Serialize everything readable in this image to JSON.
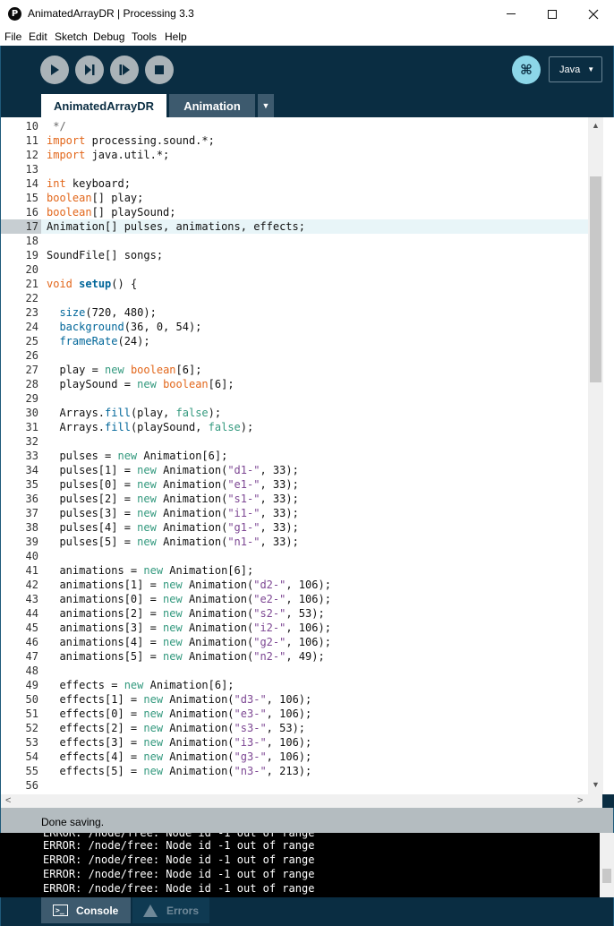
{
  "window": {
    "title": "AnimatedArrayDR | Processing 3.3",
    "app_icon_glyph": "P"
  },
  "menu": [
    "File",
    "Edit",
    "Sketch",
    "Debug",
    "Tools",
    "Help"
  ],
  "toolbar": {
    "mode_glyph": "⌘",
    "language": "Java",
    "language_caret": "▼"
  },
  "tabs": {
    "active": "AnimatedArrayDR",
    "inactive": "Animation",
    "menu_glyph": "▼"
  },
  "editor": {
    "current_line": 17,
    "lines": [
      {
        "n": "10",
        "t": [
          [
            "cm",
            " */"
          ]
        ]
      },
      {
        "n": "11",
        "t": [
          [
            "kw",
            "import"
          ],
          [
            "",
            " processing.sound.*;"
          ]
        ]
      },
      {
        "n": "12",
        "t": [
          [
            "kw",
            "import"
          ],
          [
            "",
            " java.util.*;"
          ]
        ]
      },
      {
        "n": "13",
        "t": []
      },
      {
        "n": "14",
        "t": [
          [
            "kw",
            "int"
          ],
          [
            "",
            " keyboard;"
          ]
        ]
      },
      {
        "n": "15",
        "t": [
          [
            "kw",
            "boolean"
          ],
          [
            "",
            "[] play;"
          ]
        ]
      },
      {
        "n": "16",
        "t": [
          [
            "kw",
            "boolean"
          ],
          [
            "",
            "[] playSound;"
          ]
        ]
      },
      {
        "n": "17",
        "t": [
          [
            "",
            "Animation[] pulses, animations, effects;"
          ]
        ]
      },
      {
        "n": "18",
        "t": []
      },
      {
        "n": "19",
        "t": [
          [
            "",
            "SoundFile[] songs;"
          ]
        ]
      },
      {
        "n": "20",
        "t": []
      },
      {
        "n": "21",
        "t": [
          [
            "kw",
            "void"
          ],
          [
            "",
            " "
          ],
          [
            "fnb",
            "setup"
          ],
          [
            "",
            "() {"
          ]
        ]
      },
      {
        "n": "22",
        "t": []
      },
      {
        "n": "23",
        "t": [
          [
            "",
            "  "
          ],
          [
            "fn",
            "size"
          ],
          [
            "",
            "(720, 480);"
          ]
        ]
      },
      {
        "n": "24",
        "t": [
          [
            "",
            "  "
          ],
          [
            "fn",
            "background"
          ],
          [
            "",
            "(36, 0, 54);"
          ]
        ]
      },
      {
        "n": "25",
        "t": [
          [
            "",
            "  "
          ],
          [
            "fn",
            "frameRate"
          ],
          [
            "",
            "(24);"
          ]
        ]
      },
      {
        "n": "26",
        "t": []
      },
      {
        "n": "27",
        "t": [
          [
            "",
            "  play = "
          ],
          [
            "kw2",
            "new"
          ],
          [
            "",
            " "
          ],
          [
            "kw",
            "boolean"
          ],
          [
            "",
            "[6];"
          ]
        ]
      },
      {
        "n": "28",
        "t": [
          [
            "",
            "  playSound = "
          ],
          [
            "kw2",
            "new"
          ],
          [
            "",
            " "
          ],
          [
            "kw",
            "boolean"
          ],
          [
            "",
            "[6];"
          ]
        ]
      },
      {
        "n": "29",
        "t": []
      },
      {
        "n": "30",
        "t": [
          [
            "",
            "  Arrays."
          ],
          [
            "fn",
            "fill"
          ],
          [
            "",
            "(play, "
          ],
          [
            "kw2",
            "false"
          ],
          [
            "",
            ");"
          ]
        ]
      },
      {
        "n": "31",
        "t": [
          [
            "",
            "  Arrays."
          ],
          [
            "fn",
            "fill"
          ],
          [
            "",
            "(playSound, "
          ],
          [
            "kw2",
            "false"
          ],
          [
            "",
            ");"
          ]
        ]
      },
      {
        "n": "32",
        "t": []
      },
      {
        "n": "33",
        "t": [
          [
            "",
            "  pulses = "
          ],
          [
            "kw2",
            "new"
          ],
          [
            "",
            " Animation[6];"
          ]
        ]
      },
      {
        "n": "34",
        "t": [
          [
            "",
            "  pulses[1] = "
          ],
          [
            "kw2",
            "new"
          ],
          [
            "",
            " Animation("
          ],
          [
            "str",
            "\"d1-\""
          ],
          [
            "",
            ", 33);"
          ]
        ]
      },
      {
        "n": "35",
        "t": [
          [
            "",
            "  pulses[0] = "
          ],
          [
            "kw2",
            "new"
          ],
          [
            "",
            " Animation("
          ],
          [
            "str",
            "\"e1-\""
          ],
          [
            "",
            ", 33);"
          ]
        ]
      },
      {
        "n": "36",
        "t": [
          [
            "",
            "  pulses[2] = "
          ],
          [
            "kw2",
            "new"
          ],
          [
            "",
            " Animation("
          ],
          [
            "str",
            "\"s1-\""
          ],
          [
            "",
            ", 33);"
          ]
        ]
      },
      {
        "n": "37",
        "t": [
          [
            "",
            "  pulses[3] = "
          ],
          [
            "kw2",
            "new"
          ],
          [
            "",
            " Animation("
          ],
          [
            "str",
            "\"i1-\""
          ],
          [
            "",
            ", 33);"
          ]
        ]
      },
      {
        "n": "38",
        "t": [
          [
            "",
            "  pulses[4] = "
          ],
          [
            "kw2",
            "new"
          ],
          [
            "",
            " Animation("
          ],
          [
            "str",
            "\"g1-\""
          ],
          [
            "",
            ", 33);"
          ]
        ]
      },
      {
        "n": "39",
        "t": [
          [
            "",
            "  pulses[5] = "
          ],
          [
            "kw2",
            "new"
          ],
          [
            "",
            " Animation("
          ],
          [
            "str",
            "\"n1-\""
          ],
          [
            "",
            ", 33);"
          ]
        ]
      },
      {
        "n": "40",
        "t": []
      },
      {
        "n": "41",
        "t": [
          [
            "",
            "  animations = "
          ],
          [
            "kw2",
            "new"
          ],
          [
            "",
            " Animation[6];"
          ]
        ]
      },
      {
        "n": "42",
        "t": [
          [
            "",
            "  animations[1] = "
          ],
          [
            "kw2",
            "new"
          ],
          [
            "",
            " Animation("
          ],
          [
            "str",
            "\"d2-\""
          ],
          [
            "",
            ", 106);"
          ]
        ]
      },
      {
        "n": "43",
        "t": [
          [
            "",
            "  animations[0] = "
          ],
          [
            "kw2",
            "new"
          ],
          [
            "",
            " Animation("
          ],
          [
            "str",
            "\"e2-\""
          ],
          [
            "",
            ", 106);"
          ]
        ]
      },
      {
        "n": "44",
        "t": [
          [
            "",
            "  animations[2] = "
          ],
          [
            "kw2",
            "new"
          ],
          [
            "",
            " Animation("
          ],
          [
            "str",
            "\"s2-\""
          ],
          [
            "",
            ", 53);"
          ]
        ]
      },
      {
        "n": "45",
        "t": [
          [
            "",
            "  animations[3] = "
          ],
          [
            "kw2",
            "new"
          ],
          [
            "",
            " Animation("
          ],
          [
            "str",
            "\"i2-\""
          ],
          [
            "",
            ", 106);"
          ]
        ]
      },
      {
        "n": "46",
        "t": [
          [
            "",
            "  animations[4] = "
          ],
          [
            "kw2",
            "new"
          ],
          [
            "",
            " Animation("
          ],
          [
            "str",
            "\"g2-\""
          ],
          [
            "",
            ", 106);"
          ]
        ]
      },
      {
        "n": "47",
        "t": [
          [
            "",
            "  animations[5] = "
          ],
          [
            "kw2",
            "new"
          ],
          [
            "",
            " Animation("
          ],
          [
            "str",
            "\"n2-\""
          ],
          [
            "",
            ", 49);"
          ]
        ]
      },
      {
        "n": "48",
        "t": []
      },
      {
        "n": "49",
        "t": [
          [
            "",
            "  effects = "
          ],
          [
            "kw2",
            "new"
          ],
          [
            "",
            " Animation[6];"
          ]
        ]
      },
      {
        "n": "50",
        "t": [
          [
            "",
            "  effects[1] = "
          ],
          [
            "kw2",
            "new"
          ],
          [
            "",
            " Animation("
          ],
          [
            "str",
            "\"d3-\""
          ],
          [
            "",
            ", 106);"
          ]
        ]
      },
      {
        "n": "51",
        "t": [
          [
            "",
            "  effects[0] = "
          ],
          [
            "kw2",
            "new"
          ],
          [
            "",
            " Animation("
          ],
          [
            "str",
            "\"e3-\""
          ],
          [
            "",
            ", 106);"
          ]
        ]
      },
      {
        "n": "52",
        "t": [
          [
            "",
            "  effects[2] = "
          ],
          [
            "kw2",
            "new"
          ],
          [
            "",
            " Animation("
          ],
          [
            "str",
            "\"s3-\""
          ],
          [
            "",
            ", 53);"
          ]
        ]
      },
      {
        "n": "53",
        "t": [
          [
            "",
            "  effects[3] = "
          ],
          [
            "kw2",
            "new"
          ],
          [
            "",
            " Animation("
          ],
          [
            "str",
            "\"i3-\""
          ],
          [
            "",
            ", 106);"
          ]
        ]
      },
      {
        "n": "54",
        "t": [
          [
            "",
            "  effects[4] = "
          ],
          [
            "kw2",
            "new"
          ],
          [
            "",
            " Animation("
          ],
          [
            "str",
            "\"g3-\""
          ],
          [
            "",
            ", 106);"
          ]
        ]
      },
      {
        "n": "55",
        "t": [
          [
            "",
            "  effects[5] = "
          ],
          [
            "kw2",
            "new"
          ],
          [
            "",
            " Animation("
          ],
          [
            "str",
            "\"n3-\""
          ],
          [
            "",
            ", 213);"
          ]
        ]
      },
      {
        "n": "56",
        "t": []
      }
    ]
  },
  "status": "Done saving.",
  "console": {
    "partial_top": "ERROR: /node/free: Node id -1 out of range",
    "lines": [
      "ERROR: /node/free: Node id -1 out of range",
      "ERROR: /node/free: Node id -1 out of range",
      "ERROR: /node/free: Node id -1 out of range",
      "ERROR: /node/free: Node id -1 out of range"
    ]
  },
  "bottom_tabs": {
    "console": "Console",
    "errors": "Errors"
  },
  "colors": {
    "toolbar_bg": "#0a2d42",
    "keyword": "#e2661a",
    "function": "#006699",
    "literal": "#33997e",
    "string": "#7d4793"
  }
}
